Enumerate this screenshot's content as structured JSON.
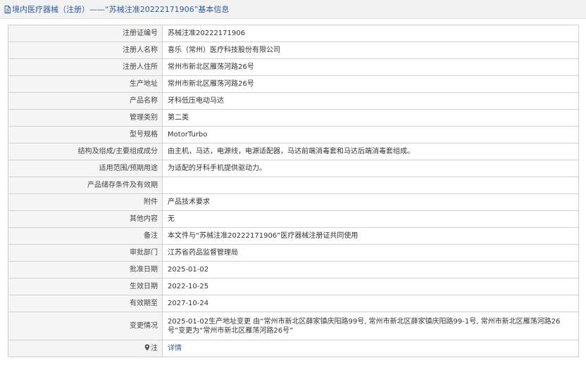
{
  "header": {
    "title": "境内医疗器械（注册）——“苏械注准20222171906”基本信息"
  },
  "rows": [
    {
      "label": "注册证编号",
      "value": "苏械注准20222171906"
    },
    {
      "label": "注册人名称",
      "value": "喜乐（常州）医疗科技股份有限公司"
    },
    {
      "label": "注册人住所",
      "value": "常州市新北区雁荡河路26号"
    },
    {
      "label": "生产地址",
      "value": "常州市新北区雁荡河路26号"
    },
    {
      "label": "产品名称",
      "value": "牙科低压电动马达"
    },
    {
      "label": "管理类别",
      "value": "第二类"
    },
    {
      "label": "型号规格",
      "value": "MotorTurbo"
    },
    {
      "label": "结构及组成/主要组成成分",
      "value": "由主机，马达，电源线，电源适配器，马达前端消毒套和马达后端消毒套组成。"
    },
    {
      "label": "适用范围/预期用途",
      "value": "为适配的牙科手机提供驱动力。"
    },
    {
      "label": "产品储存条件及有效期",
      "value": ""
    },
    {
      "label": "附件",
      "value": "产品技术要求"
    },
    {
      "label": "其他内容",
      "value": "无"
    },
    {
      "label": "备注",
      "value": "本文件与“苏械注准20222171906”医疗器械注册证共同使用"
    },
    {
      "label": "审批部门",
      "value": "江苏省药品监督管理局"
    },
    {
      "label": "批准日期",
      "value": "2025-01-02"
    },
    {
      "label": "生效日期",
      "value": "2022-10-25"
    },
    {
      "label": "有效期至",
      "value": "2027-10-24"
    },
    {
      "label": "变更情况",
      "value": "2025-01-02生产地址变更 由“常州市新北区薛家镇庆阳路99号, 常州市新北区薛家镇庆阳路99-1号, 常州市新北区雁荡河路26号”变更为“常州市新北区雁荡河路26号”"
    },
    {
      "label": "注",
      "value": "详情"
    }
  ],
  "colors": {
    "header_text": "#2c5d9a",
    "link": "#2c5d9a",
    "label_bg": "#f5f5f5",
    "border": "#cfcfcf"
  },
  "icons": {
    "header": "document-icon",
    "note": "map-pin-icon"
  }
}
